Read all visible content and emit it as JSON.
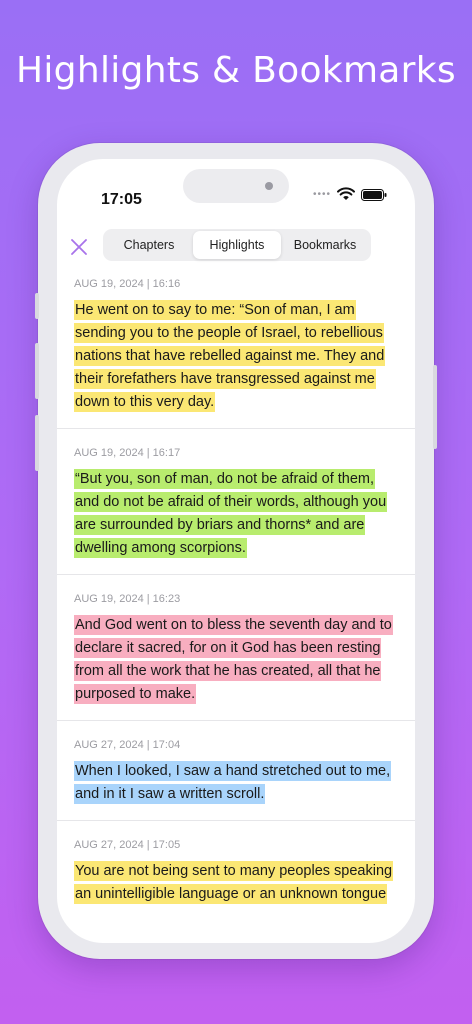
{
  "headline": "Highlights & Bookmarks",
  "status": {
    "time": "17:05",
    "signal": "••••"
  },
  "tabs": [
    {
      "label": "Chapters",
      "active": false
    },
    {
      "label": "Highlights",
      "active": true
    },
    {
      "label": "Bookmarks",
      "active": false
    }
  ],
  "colors": {
    "accent": "#a873ea",
    "yellow": "#fbe774",
    "green": "#b8ec6e",
    "pink": "#f8aec0",
    "blue": "#a9d4fb"
  },
  "icons": {
    "close": "close-icon",
    "wifi": "wifi-icon",
    "battery": "battery-icon"
  },
  "highlights": [
    {
      "date": "AUG 19, 2024 | 16:16",
      "color": "#fbe774",
      "text": "He went on to say to me: “Son of man, I am sending you to the people of Israel, to rebellious nations that have rebelled against me. They and their forefathers have transgressed against me down to this very day."
    },
    {
      "date": "AUG 19, 2024 | 16:17",
      "color": "#b8ec6e",
      "text": "“But you, son of man, do not be afraid of them, and do not be afraid of their words, although you are surrounded by briars and thorns* and are dwelling among scorpions."
    },
    {
      "date": "AUG 19, 2024 | 16:23",
      "color": "#f8aec0",
      "text": "And God went on to bless the seventh day and to declare it sacred, for on it God has been resting from all the work that he has created, all that he purposed to make."
    },
    {
      "date": "AUG 27, 2024 | 17:04",
      "color": "#a9d4fb",
      "text": "When I looked, I saw a hand stretched out to me, and in it I saw a written scroll."
    },
    {
      "date": "AUG 27, 2024 | 17:05",
      "color": "#fbe774",
      "text": "You are not being sent to many peoples speaking an unintelligible language or an unknown tongue"
    }
  ]
}
